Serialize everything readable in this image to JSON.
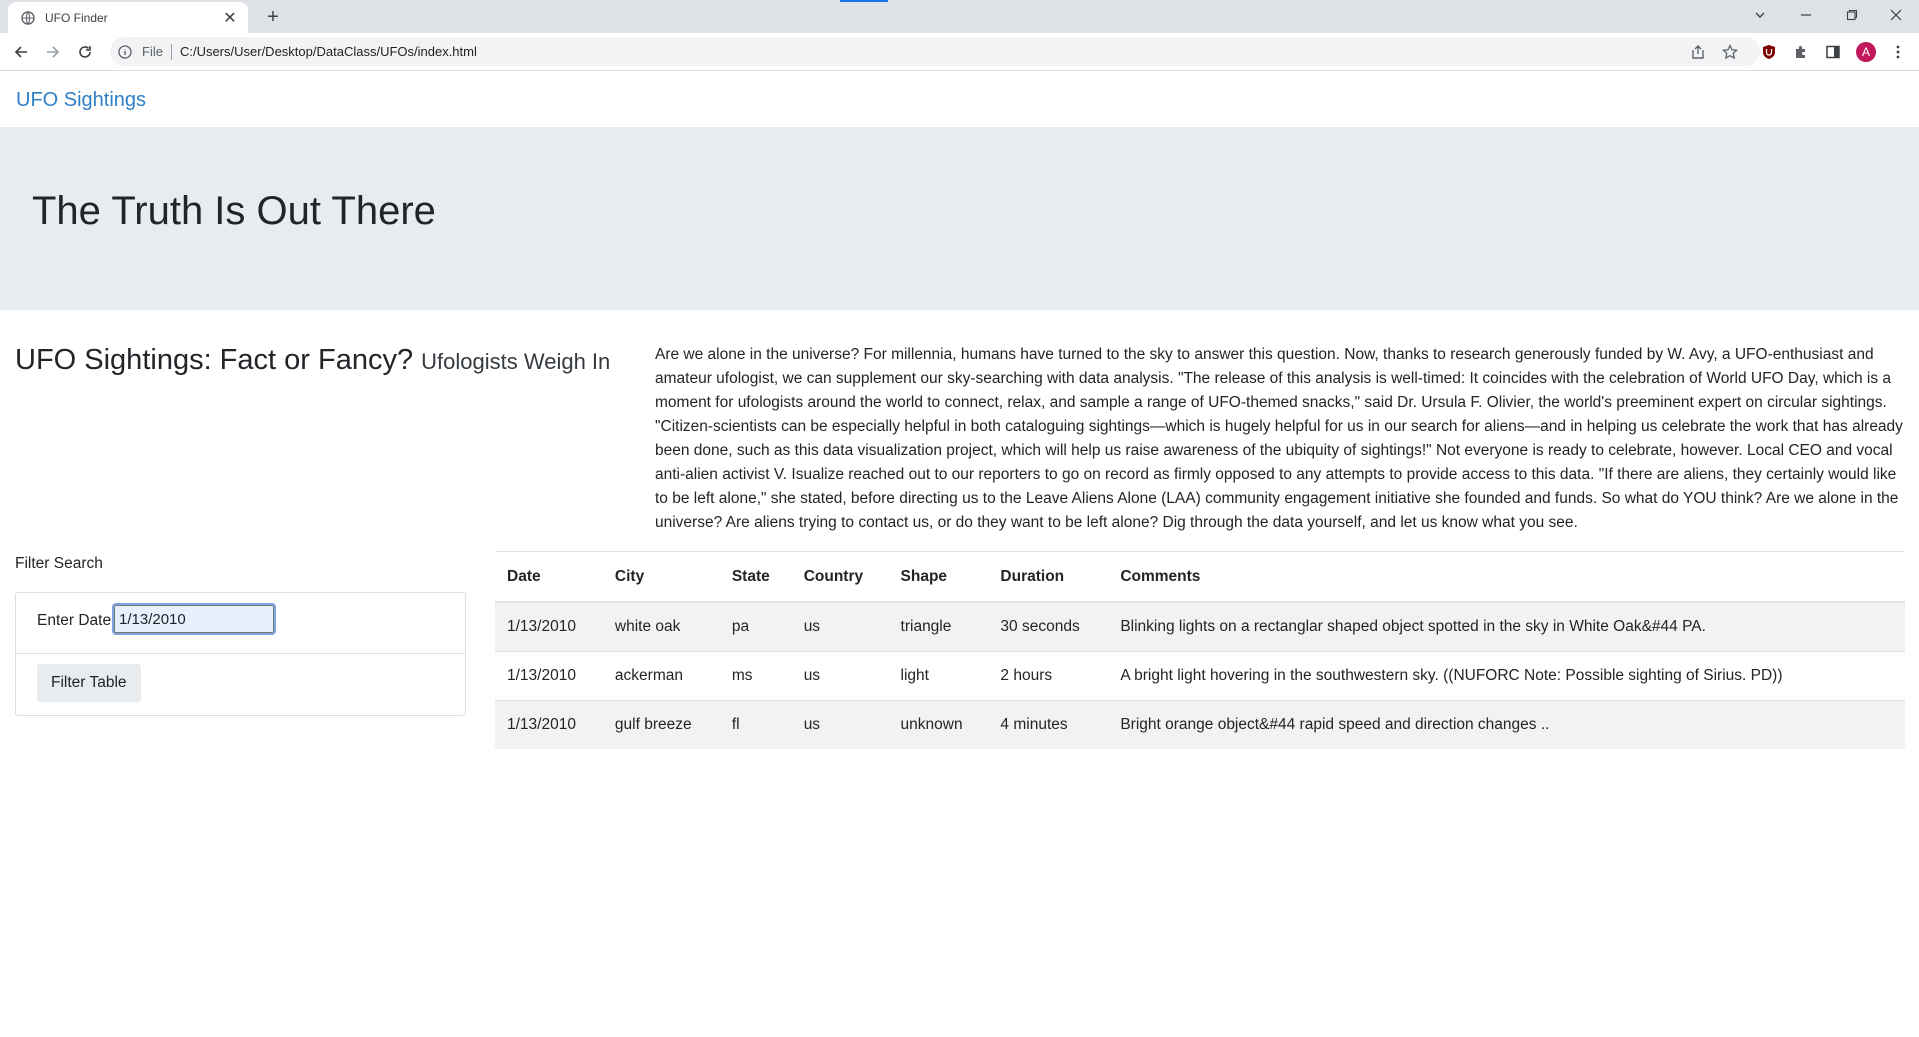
{
  "browser": {
    "tab_title": "UFO Finder",
    "omnibox_scheme": "File",
    "url": "C:/Users/User/Desktop/DataClass/UFOs/index.html",
    "profile_initial": "A"
  },
  "nav": {
    "brand": "UFO Sightings"
  },
  "hero": {
    "title": "The Truth Is Out There"
  },
  "article": {
    "title": "UFO Sightings: Fact or Fancy?",
    "subtitle": "Ufologists Weigh In",
    "body": "Are we alone in the universe? For millennia, humans have turned to the sky to answer this question. Now, thanks to research generously funded by W. Avy, a UFO-enthusiast and amateur ufologist, we can supplement our sky-searching with data analysis. \"The release of this analysis is well-timed: It coincides with the celebration of World UFO Day, which is a moment for ufologists around the world to connect, relax, and sample a range of UFO-themed snacks,\" said Dr. Ursula F. Olivier, the world's preeminent expert on circular sightings. \"Citizen-scientists can be especially helpful in both cataloguing sightings—which is hugely helpful for us in our search for aliens—and in helping us celebrate the work that has already been done, such as this data visualization project, which will help us raise awareness of the ubiquity of sightings!\" Not everyone is ready to celebrate, however. Local CEO and vocal anti-alien activist V. Isualize reached out to our reporters to go on record as firmly opposed to any attempts to provide access to this data. \"If there are aliens, they certainly would like to be left alone,\" she stated, before directing us to the Leave Aliens Alone (LAA) community engagement initiative she founded and funds. So what do YOU think? Are we alone in the universe? Are aliens trying to contact us, or do they want to be left alone? Dig through the data yourself, and let us know what you see."
  },
  "filter": {
    "heading": "Filter Search",
    "date_label": "Enter Date",
    "date_value": "1/13/2010",
    "button_label": "Filter Table"
  },
  "table": {
    "headers": [
      "Date",
      "City",
      "State",
      "Country",
      "Shape",
      "Duration",
      "Comments"
    ],
    "rows": [
      [
        "1/13/2010",
        "white oak",
        "pa",
        "us",
        "triangle",
        "30 seconds",
        "Blinking lights on a rectanglar shaped object spotted in the sky in White Oak&#44 PA."
      ],
      [
        "1/13/2010",
        "ackerman",
        "ms",
        "us",
        "light",
        "2 hours",
        "A bright light hovering in the southwestern sky. ((NUFORC Note: Possible sighting of Sirius. PD))"
      ],
      [
        "1/13/2010",
        "gulf breeze",
        "fl",
        "us",
        "unknown",
        "4 minutes",
        "Bright orange object&#44 rapid speed and direction changes .."
      ]
    ]
  },
  "colors": {
    "link": "#2f80c7",
    "jumbotron_bg": "#e9ecef",
    "stripe_bg": "#f2f2f2",
    "avatar_bg": "#c2185b"
  }
}
